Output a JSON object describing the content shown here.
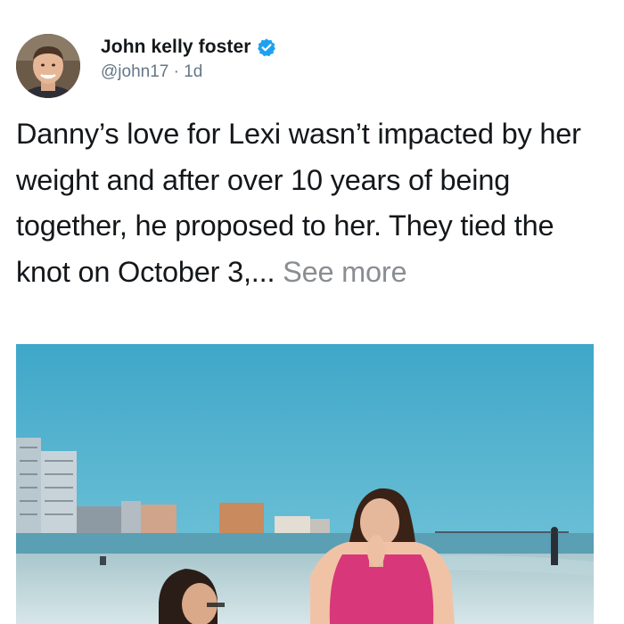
{
  "author": {
    "name": "John kelly foster",
    "handle": "@john17",
    "separator": "·",
    "time": "1d",
    "verified": true,
    "avatar_icon": "profile-photo"
  },
  "post": {
    "text": "Danny’s love for Lexi wasn’t impacted by her weight and after over 10 years of being together, he proposed to her. They tied the knot on October 3,...",
    "see_more": "See more"
  },
  "media": {
    "icon": "beach-proposal-photo"
  },
  "colors": {
    "text": "#14171a",
    "secondary": "#657786",
    "see_more": "#8a8d91",
    "verified": "#1da1f2",
    "sky": "#4fb1cf",
    "sea": "#5fa3b7",
    "sand": "#cfe0e2",
    "shirt": "#d8387a"
  }
}
